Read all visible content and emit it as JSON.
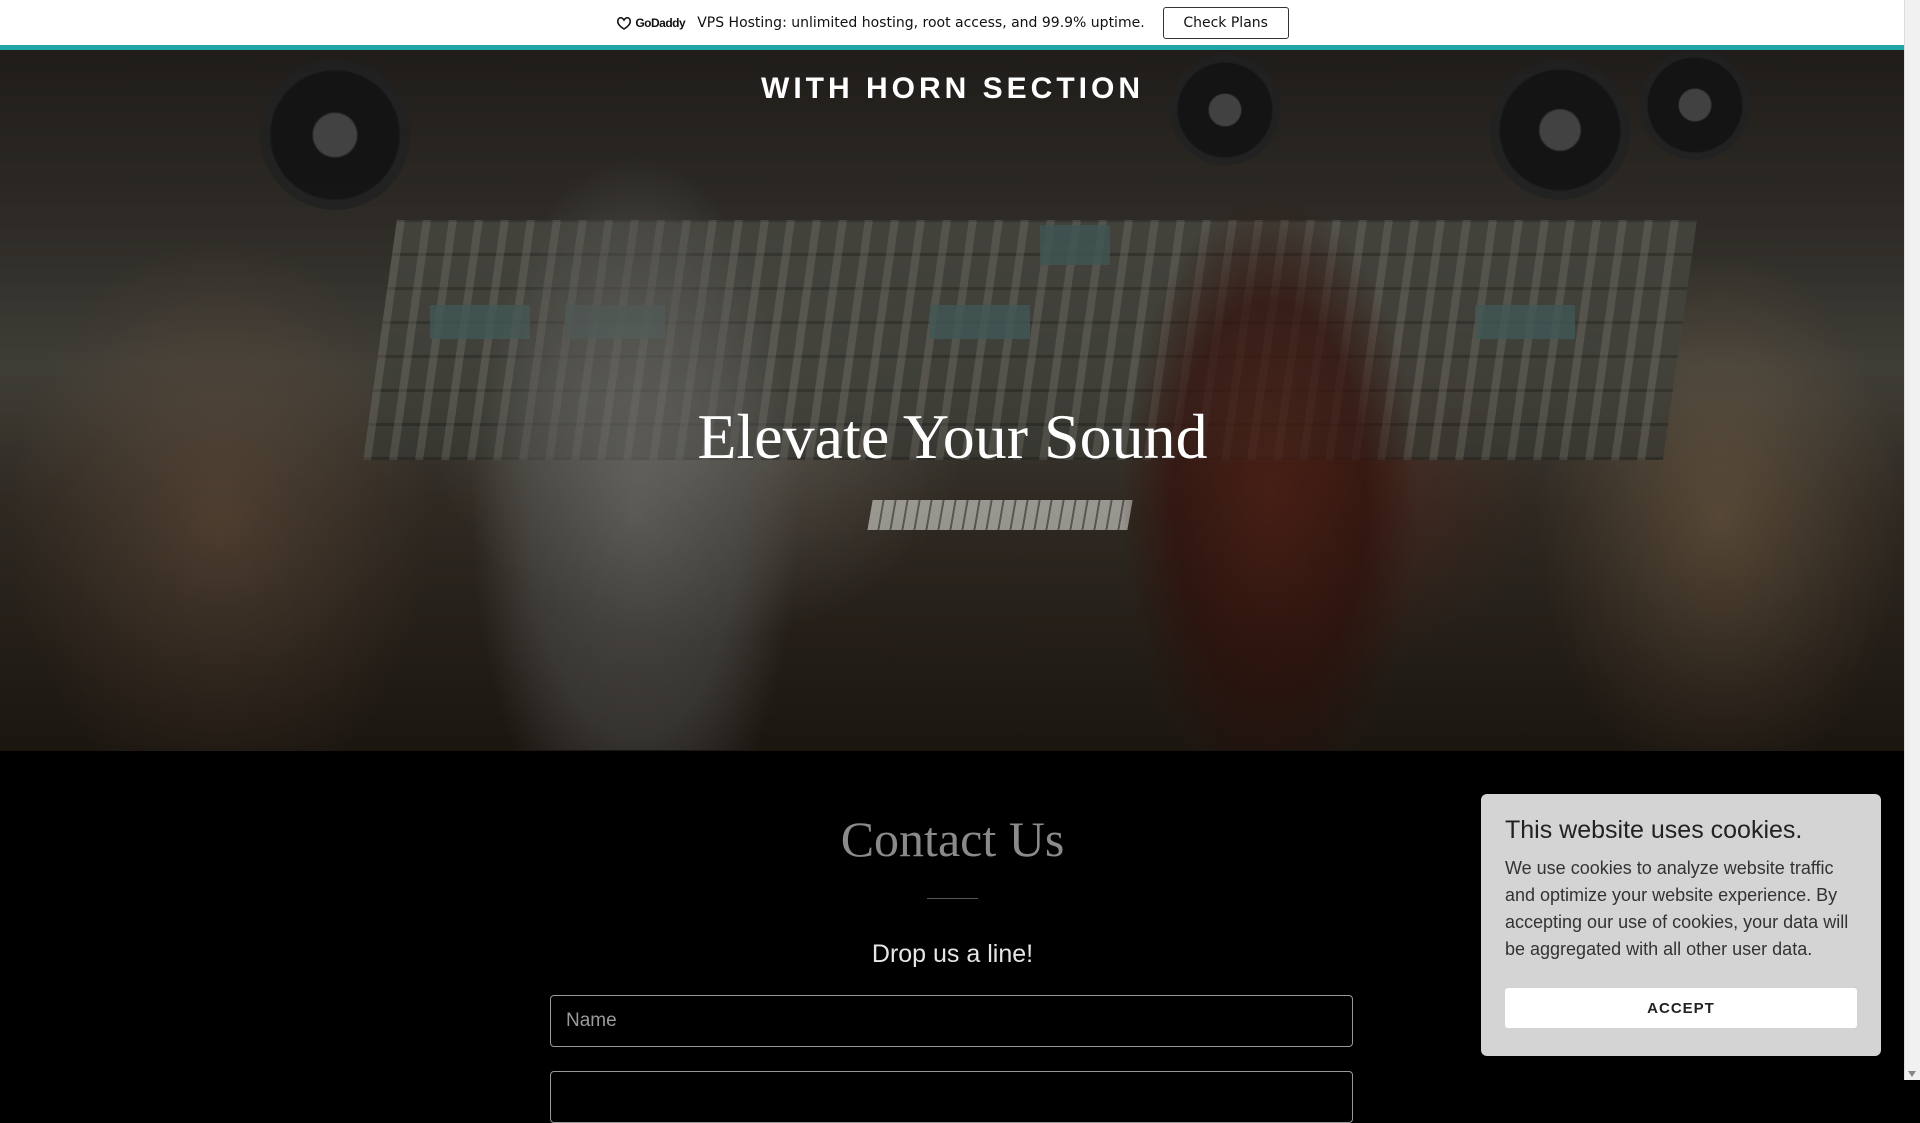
{
  "promo": {
    "logo_text": "GoDaddy",
    "message": "VPS Hosting: unlimited hosting, root access, and 99.9% uptime.",
    "button_label": "Check Plans",
    "accent_color": "#1fa5a5"
  },
  "hero": {
    "site_name": "WITH HORN SECTION",
    "title": "Elevate Your Sound"
  },
  "contact": {
    "title": "Contact Us",
    "subtitle": "Drop us a line!",
    "name_placeholder": "Name"
  },
  "cookie_banner": {
    "title": "This website uses cookies.",
    "text": "We use cookies to analyze website traffic and optimize your website experience. By accepting our use of cookies, your data will be aggregated with all other user data.",
    "accept_label": "ACCEPT"
  }
}
